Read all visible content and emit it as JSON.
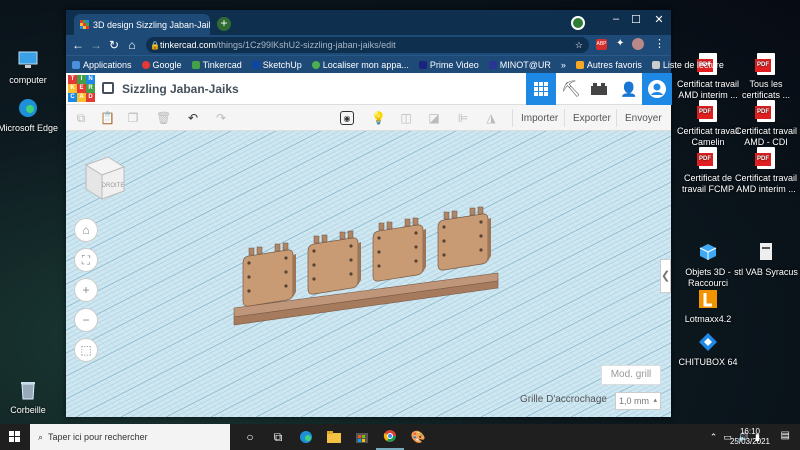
{
  "desktop": {
    "left_icons": [
      {
        "label": "computer"
      },
      {
        "label": "Microsoft Edge"
      },
      {
        "label": "Corbeille"
      }
    ],
    "right_icons": [
      {
        "label": "Certificat travail AMD interim ..."
      },
      {
        "label": "Tous les certificats ..."
      },
      {
        "label": "Certificat travail Camelin"
      },
      {
        "label": "Certificat travail AMD - CDI"
      },
      {
        "label": "Certificat de travail FCMP"
      },
      {
        "label": "Certificat travail AMD interim ..."
      },
      {
        "label": "Objets 3D - Raccourci"
      },
      {
        "label": "stl VAB Syracus"
      },
      {
        "label": "Lotmaxx4.2"
      },
      {
        "label": "CHITUBOX 64"
      }
    ]
  },
  "browser": {
    "tab_title": "3D design Sizzling Jaban-Jaiks | T",
    "url_domain": "tinkercad.com",
    "url_path": "/things/1Cz99lKshU2-sizzling-jaban-jaiks/edit",
    "bookmarks": [
      "Applications",
      "Google",
      "Tinkercad",
      "SketchUp",
      "Localiser mon appa...",
      "Prime Video",
      "MINOT@UR",
      "»",
      "Autres favoris",
      "Liste de lecture"
    ]
  },
  "tinkercad": {
    "logo_letters": [
      "T",
      "I",
      "N",
      "K",
      "E",
      "R",
      "C",
      "A",
      "D"
    ],
    "project_title": "Sizzling Jaban-Jaiks",
    "import_label": "Importer",
    "export_label": "Exporter",
    "send_label": "Envoyer",
    "viewcube_label": "DROITE",
    "edit_grid_label": "Mod. grill",
    "snap_label": "Grille D'accrochage",
    "snap_value": "1,0 mm"
  },
  "taskbar": {
    "search_placeholder": "Taper ici pour rechercher",
    "time": "16:10",
    "date": "25/03/2021"
  },
  "colors": {
    "shape": "#c89b74",
    "shape_dark": "#8e6b4e",
    "bar_top": "#c0967a",
    "workplane": "#cfe7f1",
    "chrome": "#1e4a78"
  }
}
